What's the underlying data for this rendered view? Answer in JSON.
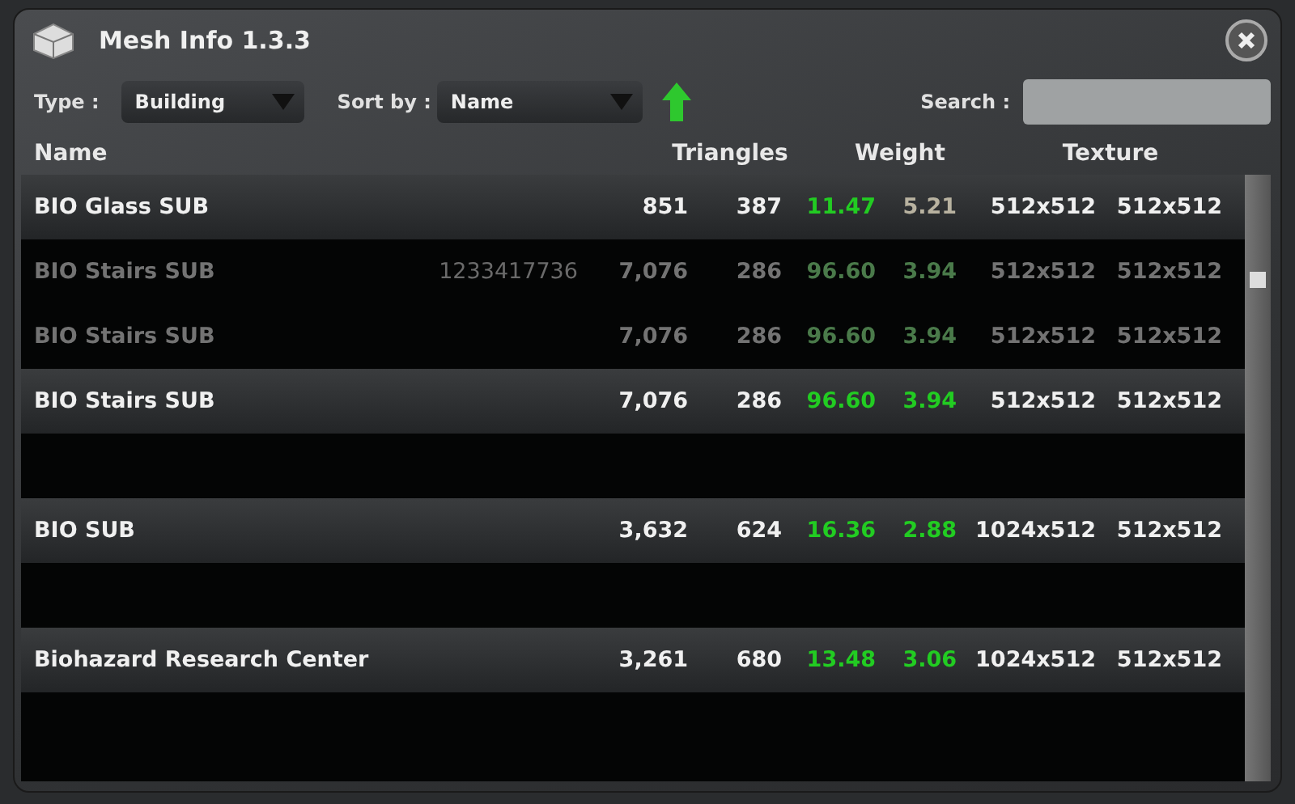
{
  "window": {
    "title": "Mesh Info 1.3.3"
  },
  "filters": {
    "type_label": "Type :",
    "type_value": "Building",
    "sort_label": "Sort by :",
    "sort_value": "Name",
    "sort_ascending": true,
    "search_label": "Search :"
  },
  "columns": [
    {
      "label": "Name"
    },
    {
      "label": "Triangles"
    },
    {
      "label": "Weight"
    },
    {
      "label": "Texture"
    }
  ],
  "rows": [
    {
      "kind": "item",
      "faded": false,
      "name": "BIO Glass SUB",
      "triangles": [
        "851",
        "387"
      ],
      "weight": [
        {
          "value": "11.47",
          "color": "#22cc22"
        },
        {
          "value": "5.21",
          "color": "#b8b2a0"
        }
      ],
      "texture": [
        "512x512",
        "512x512"
      ]
    },
    {
      "kind": "item",
      "faded": true,
      "name": "BIO Stairs SUB",
      "extra": "1233417736",
      "triangles": [
        "7,076",
        "286"
      ],
      "weight": [
        {
          "value": "96.60",
          "color": "#4a7a4a"
        },
        {
          "value": "3.94",
          "color": "#4a7a4a"
        }
      ],
      "texture": [
        "512x512",
        "512x512"
      ]
    },
    {
      "kind": "item",
      "faded": true,
      "name": "BIO Stairs SUB",
      "triangles": [
        "7,076",
        "286"
      ],
      "weight": [
        {
          "value": "96.60",
          "color": "#4a7a4a"
        },
        {
          "value": "3.94",
          "color": "#4a7a4a"
        }
      ],
      "texture": [
        "512x512",
        "512x512"
      ]
    },
    {
      "kind": "item",
      "faded": false,
      "name": "BIO Stairs SUB",
      "triangles": [
        "7,076",
        "286"
      ],
      "weight": [
        {
          "value": "96.60",
          "color": "#22cc22"
        },
        {
          "value": "3.94",
          "color": "#22cc22"
        }
      ],
      "texture": [
        "512x512",
        "512x512"
      ]
    },
    {
      "kind": "blank"
    },
    {
      "kind": "item",
      "faded": false,
      "name": "BIO SUB",
      "triangles": [
        "3,632",
        "624"
      ],
      "weight": [
        {
          "value": "16.36",
          "color": "#22cc22"
        },
        {
          "value": "2.88",
          "color": "#22cc22"
        }
      ],
      "texture": [
        "1024x512",
        "512x512"
      ]
    },
    {
      "kind": "blank"
    },
    {
      "kind": "item",
      "faded": false,
      "name": "Biohazard Research Center",
      "triangles": [
        "3,261",
        "680"
      ],
      "weight": [
        {
          "value": "13.48",
          "color": "#22cc22"
        },
        {
          "value": "3.06",
          "color": "#22cc22"
        }
      ],
      "texture": [
        "1024x512",
        "512x512"
      ]
    },
    {
      "kind": "blank"
    }
  ]
}
